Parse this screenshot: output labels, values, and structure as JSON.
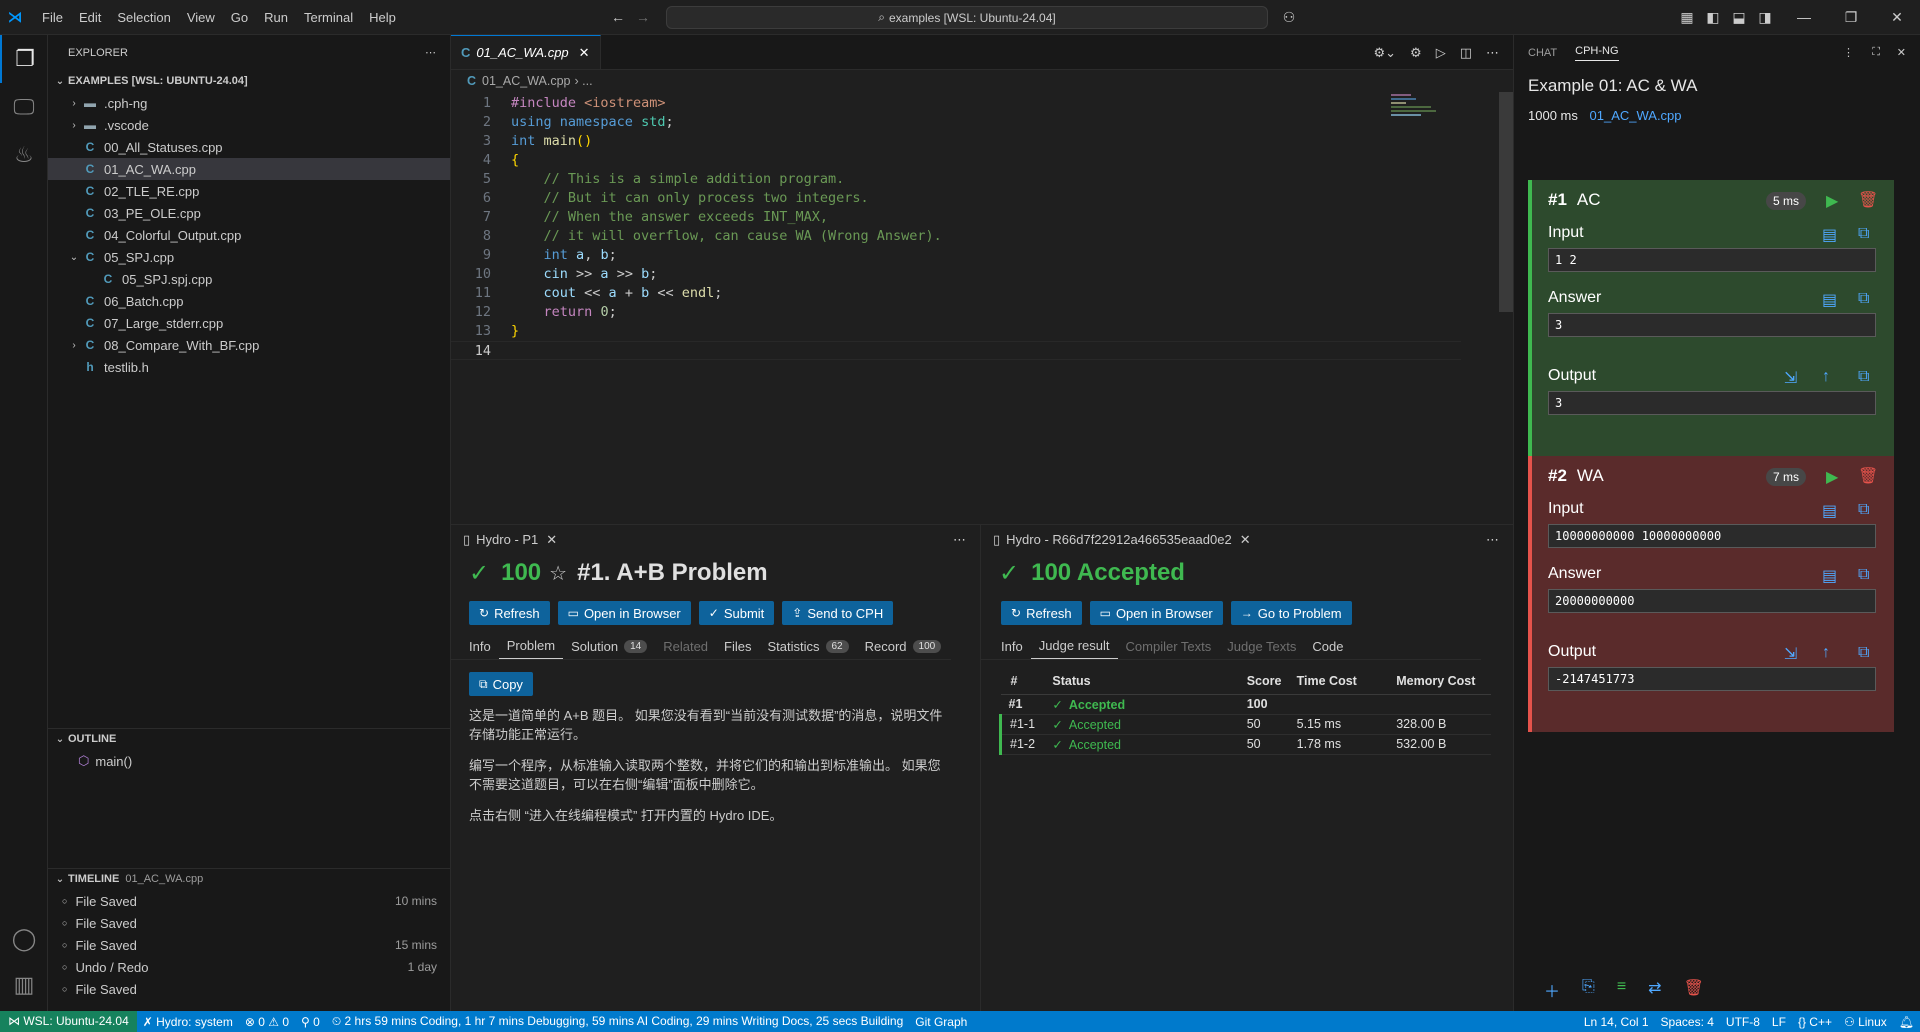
{
  "titlebar": {
    "menus": [
      "File",
      "Edit",
      "Selection",
      "View",
      "Go",
      "Run",
      "Terminal",
      "Help"
    ],
    "command_center": "examples [WSL: Ubuntu-24.04]"
  },
  "explorer": {
    "header": "EXPLORER",
    "root": "EXAMPLES [WSL: UBUNTU-24.04]",
    "items": [
      {
        "label": ".cph-ng",
        "kind": "folder",
        "chevron": "›"
      },
      {
        "label": ".vscode",
        "kind": "folder",
        "chevron": "›"
      },
      {
        "label": "00_All_Statuses.cpp",
        "kind": "cpp"
      },
      {
        "label": "01_AC_WA.cpp",
        "kind": "cpp"
      },
      {
        "label": "02_TLE_RE.cpp",
        "kind": "cpp"
      },
      {
        "label": "03_PE_OLE.cpp",
        "kind": "cpp"
      },
      {
        "label": "04_Colorful_Output.cpp",
        "kind": "cpp"
      },
      {
        "label": "05_SPJ.cpp",
        "kind": "cpp",
        "chevron": "⌄"
      },
      {
        "label": "05_SPJ.spj.cpp",
        "kind": "cpp",
        "indent": true
      },
      {
        "label": "06_Batch.cpp",
        "kind": "cpp"
      },
      {
        "label": "07_Large_stderr.cpp",
        "kind": "cpp"
      },
      {
        "label": "08_Compare_With_BF.cpp",
        "kind": "cpp",
        "chevron": "›"
      },
      {
        "label": "testlib.h",
        "kind": "h"
      }
    ],
    "outline_header": "OUTLINE",
    "outline_item": "main()",
    "timeline_header": "TIMELINE",
    "timeline_file": "01_AC_WA.cpp",
    "timeline": [
      {
        "label": "File Saved",
        "time": "10 mins"
      },
      {
        "label": "File Saved",
        "time": ""
      },
      {
        "label": "File Saved",
        "time": "15 mins"
      },
      {
        "label": "Undo / Redo",
        "time": "1 day"
      },
      {
        "label": "File Saved",
        "time": ""
      }
    ]
  },
  "editor": {
    "tab": "01_AC_WA.cpp",
    "breadcrumb": "01_AC_WA.cpp",
    "breadcrumb_rest": "› ...",
    "lines": [
      "1",
      "2",
      "3",
      "4",
      "5",
      "6",
      "7",
      "8",
      "9",
      "10",
      "11",
      "12",
      "13",
      "14"
    ]
  },
  "hydro_problem": {
    "tab": "Hydro - P1",
    "score": "100",
    "title": "#1. A+B Problem",
    "buttons": [
      "Refresh",
      "Open in Browser",
      "Submit",
      "Send to CPH"
    ],
    "tabs": [
      {
        "label": "Info"
      },
      {
        "label": "Problem"
      },
      {
        "label": "Solution",
        "badge": "14"
      },
      {
        "label": "Related"
      },
      {
        "label": "Files"
      },
      {
        "label": "Statistics",
        "badge": "62"
      },
      {
        "label": "Record",
        "badge": "100"
      }
    ],
    "copy": "Copy",
    "p1": "这是一道简单的 A+B 题目。 如果您没有看到“当前没有测试数据”的消息，说明文件存储功能正常运行。",
    "p2": "编写一个程序，从标准输入读取两个整数，并将它们的和输出到标准输出。 如果您不需要这道题目，可以在右侧“编辑”面板中删除它。",
    "p3": "点击右侧 “进入在线编程模式” 打开内置的 Hydro IDE。"
  },
  "hydro_record": {
    "tab": "Hydro - R66d7f22912a466535eaad0e2",
    "title": "100 Accepted",
    "buttons": [
      "Refresh",
      "Open in Browser",
      "Go to Problem"
    ],
    "tabs": [
      "Info",
      "Judge result",
      "Compiler Texts",
      "Judge Texts",
      "Code"
    ],
    "columns": [
      "#",
      "Status",
      "Score",
      "Time Cost",
      "Memory Cost"
    ],
    "rows": [
      {
        "id": "#1",
        "status": "Accepted",
        "score": "100",
        "time": "",
        "memory": ""
      },
      {
        "id": "#1-1",
        "status": "Accepted",
        "score": "50",
        "time": "5.15 ms",
        "memory": "328.00 B"
      },
      {
        "id": "#1-2",
        "status": "Accepted",
        "score": "50",
        "time": "1.78 ms",
        "memory": "532.00 B"
      }
    ]
  },
  "cph": {
    "tabs": [
      "CHAT",
      "CPH-NG"
    ],
    "title": "Example 01: AC & WA",
    "time_limit": "1000 ms",
    "file": "01_AC_WA.cpp",
    "cases": [
      {
        "name": "#1",
        "verdict": "AC",
        "time": "5 ms",
        "input": "1 2",
        "answer": "3",
        "output": "3"
      },
      {
        "name": "#2",
        "verdict": "WA",
        "time": "7 ms",
        "input": "10000000000 10000000000",
        "answer": "20000000000",
        "output": "-2147451773"
      }
    ],
    "labels": {
      "input": "Input",
      "answer": "Answer",
      "output": "Output"
    }
  },
  "statusbar": {
    "remote": "WSL: Ubuntu-24.04",
    "hydro": "Hydro: system",
    "errors": "0",
    "warnings": "0",
    "ports": "0",
    "wakatime": "2 hrs 59 mins Coding, 1 hr 7 mins Debugging, 59 mins AI Coding, 29 mins Writing Docs, 25 secs Building",
    "git": "Git Graph",
    "position": "Ln 14, Col 1",
    "spaces": "Spaces: 4",
    "encoding": "UTF-8",
    "eol": "LF",
    "lang": "C++",
    "os": "Linux"
  },
  "colors": {
    "accent": "#0078d4",
    "statusbar": "#007acc",
    "ac": "#3fb950",
    "wa": "#e5534b",
    "button": "#0e639c"
  }
}
